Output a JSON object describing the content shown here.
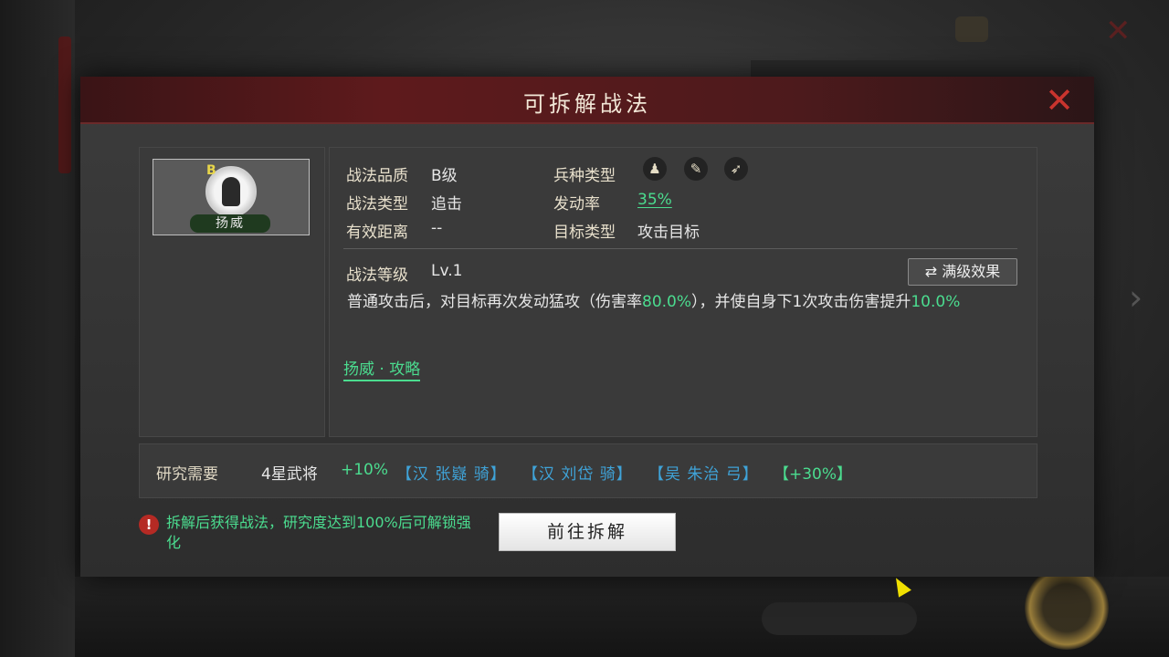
{
  "dialog": {
    "title": "可拆解战法"
  },
  "skill_card": {
    "grade": "B",
    "name": "扬威"
  },
  "info": {
    "quality_label": "战法品质",
    "quality_value": "B级",
    "type_label": "战法类型",
    "type_value": "追击",
    "range_label": "有效距离",
    "range_value": "--",
    "troop_label": "兵种类型",
    "troop_icons": [
      "infantry-icon",
      "spear-icon",
      "bow-icon"
    ],
    "rate_label": "发动率",
    "rate_value": "35%",
    "target_label": "目标类型",
    "target_value": "攻击目标",
    "level_label": "战法等级",
    "level_value": "Lv.1",
    "max_level_button": "满级效果"
  },
  "description": {
    "part1": "普通攻击后，对目标再次发动猛攻（伤害率",
    "damage_rate": "80.0%",
    "part2": "），并使自身下1次攻击伤害提升",
    "boost": "10.0%"
  },
  "strategy_link": "扬威 · 攻略",
  "research": {
    "label": "研究需要",
    "requirement": "4星武将",
    "bonus": "+10%",
    "generals": [
      "【汉 张嶷 骑】",
      "【汉 刘岱 骑】",
      "【吴 朱治 弓】"
    ],
    "extra_bonus": "【+30%】"
  },
  "warning": {
    "icon": "!",
    "text": "拆解后获得战法，研究度达到100%后可解锁强化"
  },
  "go_button": "前往拆解",
  "background": {
    "close_glyph": "✕",
    "arrow_glyph": "›"
  },
  "colors": {
    "green": "#4bdc8f",
    "blue": "#3fa3d8",
    "header_red": "#5e1a1c",
    "close_red": "#c9342e"
  }
}
